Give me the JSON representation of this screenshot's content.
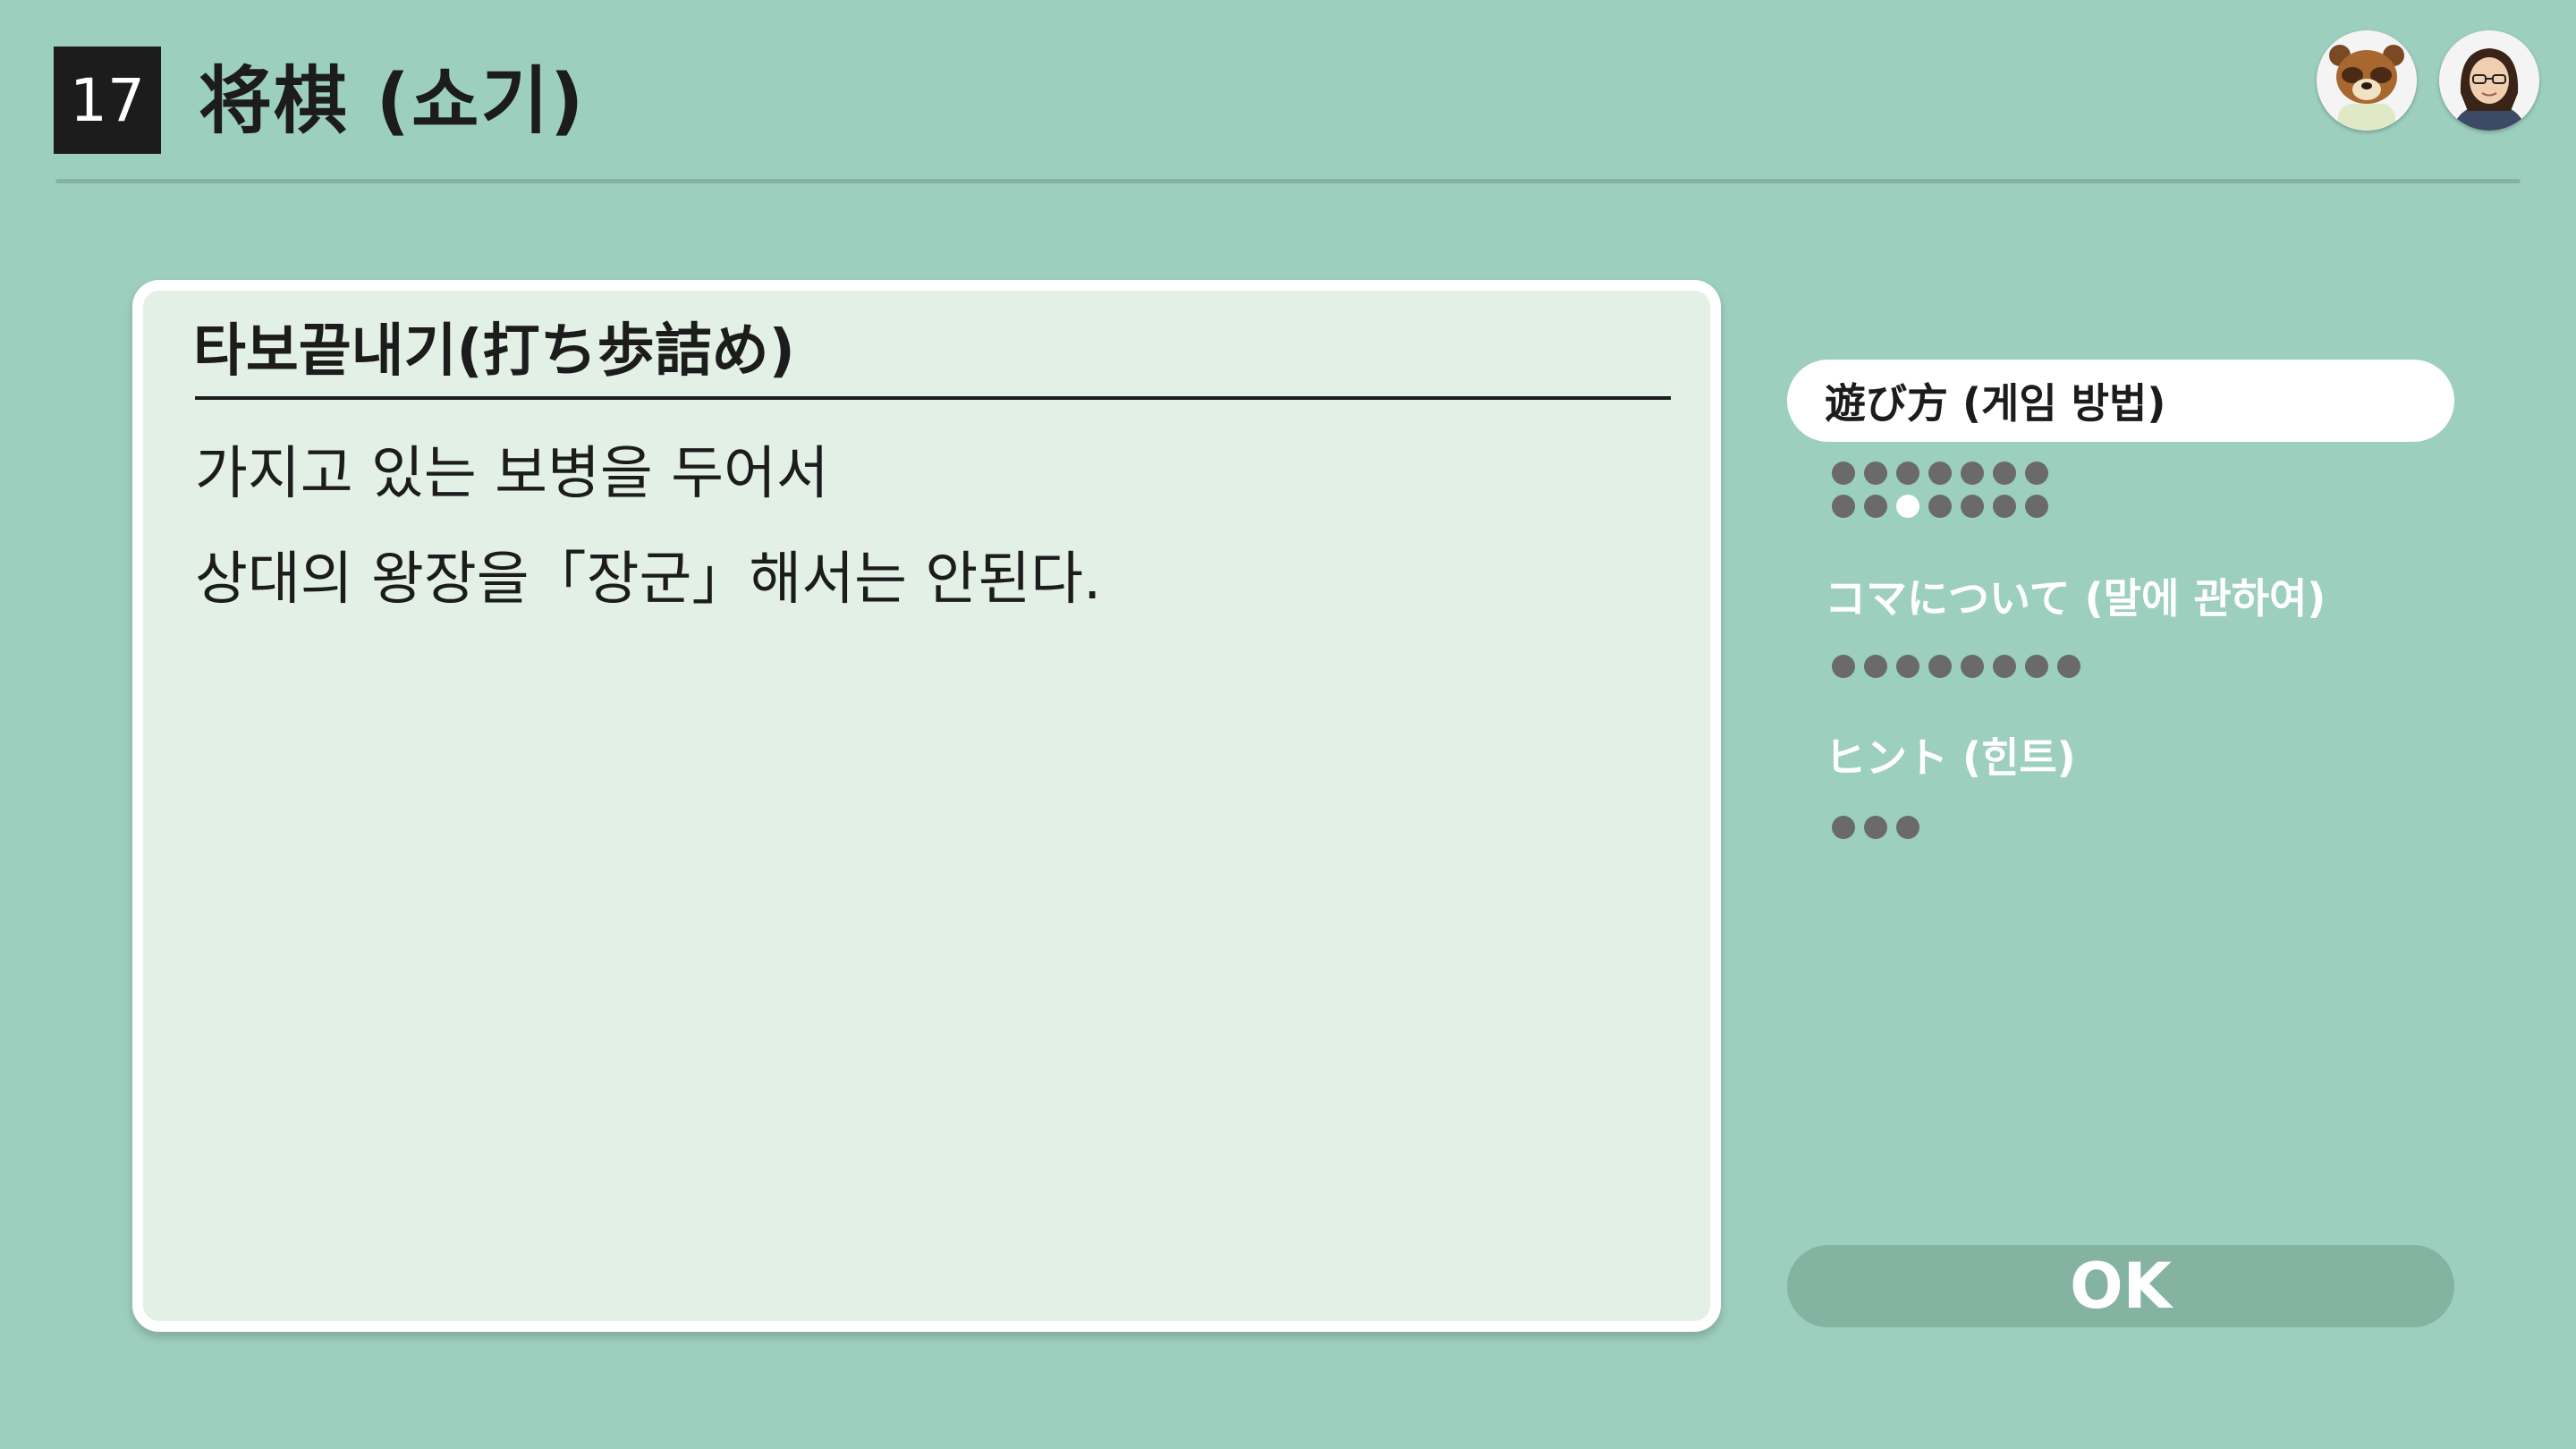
{
  "header": {
    "number": "17",
    "title": "将棋 (쇼기)"
  },
  "avatars": [
    {
      "name": "tom-nook-avatar"
    },
    {
      "name": "player-avatar"
    }
  ],
  "panel": {
    "title": "타보끝내기(打ち歩詰め)",
    "lines": [
      "가지고 있는 보병을 두어서",
      "상대의 왕장을「장군」해서는 안된다."
    ]
  },
  "menu": {
    "items": [
      {
        "label": "遊び方 (게임 방법)",
        "active": true,
        "pages": 14,
        "current_page": 10
      },
      {
        "label": "コマについて (말에 관하여)",
        "active": false,
        "pages": 8
      },
      {
        "label": "ヒント (힌트)",
        "active": false,
        "pages": 3
      }
    ]
  },
  "ok_button": {
    "label": "OK"
  },
  "colors": {
    "background": "#9dcfbe",
    "panel": "#e2f0e6",
    "dot": "#6a6a6a",
    "ok": "#84b3a2"
  }
}
